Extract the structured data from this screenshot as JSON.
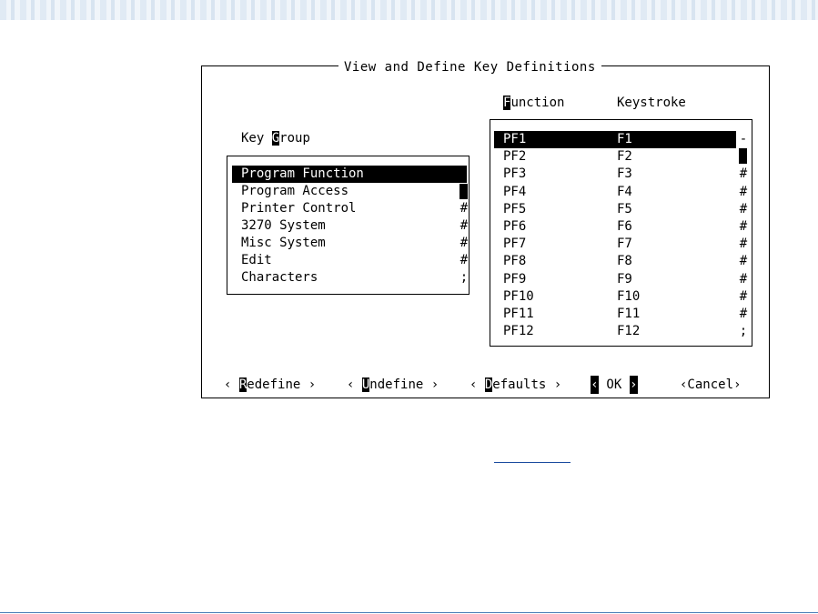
{
  "dialog": {
    "title": "View and Define Key Definitions"
  },
  "key_group": {
    "label_prefix": "Key ",
    "label_hotkey": "G",
    "label_suffix": "roup",
    "items": [
      "Program Function",
      "Program Access",
      "Printer Control",
      "3270 System",
      "Misc System",
      "Edit",
      "Characters"
    ],
    "selected_index": 0,
    "scroll_marks": [
      "-",
      "",
      "#",
      "#",
      "#",
      "#",
      ";"
    ]
  },
  "function_list": {
    "col1_hotkey": "F",
    "col1_rest": "unction",
    "col2_label": "Keystroke",
    "rows": [
      {
        "function": "PF1",
        "keystroke": "F1"
      },
      {
        "function": "PF2",
        "keystroke": "F2"
      },
      {
        "function": "PF3",
        "keystroke": "F3"
      },
      {
        "function": "PF4",
        "keystroke": "F4"
      },
      {
        "function": "PF5",
        "keystroke": "F5"
      },
      {
        "function": "PF6",
        "keystroke": "F6"
      },
      {
        "function": "PF7",
        "keystroke": "F7"
      },
      {
        "function": "PF8",
        "keystroke": "F8"
      },
      {
        "function": "PF9",
        "keystroke": "F9"
      },
      {
        "function": "PF10",
        "keystroke": "F10"
      },
      {
        "function": "PF11",
        "keystroke": "F11"
      },
      {
        "function": "PF12",
        "keystroke": "F12"
      }
    ],
    "selected_index": 0,
    "scroll_marks": [
      "-",
      "",
      "#",
      "#",
      "#",
      "#",
      "#",
      "#",
      "#",
      "#",
      "#",
      ";"
    ]
  },
  "buttons": {
    "redefine": {
      "open": "‹ ",
      "hotkey": "R",
      "rest": "edefine ›"
    },
    "undefine": {
      "open": "‹ ",
      "hotkey": "U",
      "rest": "ndefine ›"
    },
    "defaults": {
      "open": "‹ ",
      "hotkey": "D",
      "rest": "efaults ›"
    },
    "ok": {
      "left": "‹",
      "label": " OK ",
      "right": "›"
    },
    "cancel": {
      "label": "‹Cancel›"
    }
  }
}
